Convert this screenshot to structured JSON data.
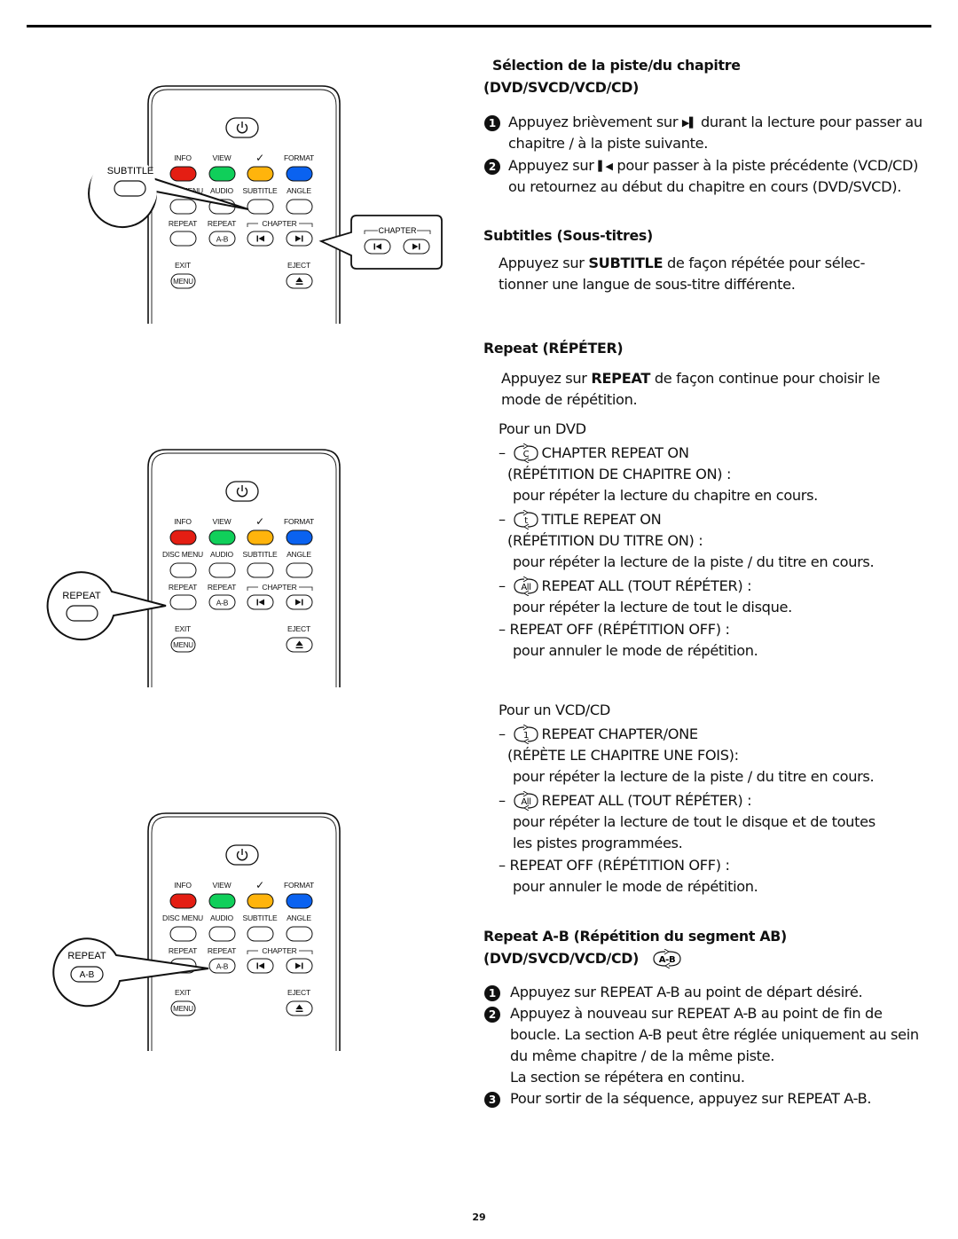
{
  "page_number": "29",
  "colors": {
    "info": "#e41e13",
    "view": "#10cf5a",
    "check": "#ffb40c",
    "format": "#0a62f0"
  },
  "remote": {
    "row1": [
      "INFO",
      "VIEW",
      "✓",
      "FORMAT"
    ],
    "row2": [
      "DISC MENU",
      "AUDIO",
      "SUBTITLE",
      "ANGLE"
    ],
    "row3": [
      "REPEAT",
      "REPEAT",
      "CHAPTER"
    ],
    "ab_label": "A-B",
    "exit_label": "EXIT",
    "menu_label": "MENU",
    "eject_label": "EJECT",
    "prev_icon": "skip-previous-icon",
    "next_icon": "skip-next-icon",
    "power_icon": "power-icon",
    "eject_icon": "eject-icon"
  },
  "callouts": {
    "subtitle": "SUBTITLE",
    "chapter": "CHAPTER",
    "repeat": "REPEAT",
    "repeat_ab": {
      "label": "REPEAT",
      "button": "A-B"
    }
  },
  "sections": {
    "chapter_select": {
      "title_line1": "Sélection de la piste/du chapitre",
      "title_line2": "(DVD/SVCD/VCD/CD)",
      "steps": [
        {
          "n": "1",
          "pre": "Appuyez brièvement sur ",
          "icon": "skip-next-icon",
          "post": " durant la lecture pour passer au",
          "line2": "chapitre / à la piste suivante."
        },
        {
          "n": "2",
          "pre": "Appuyez sur ",
          "icon": "skip-previous-icon",
          "post": " pour passer à la piste précédente (VCD/CD)",
          "line2": "ou retournez au début du chapitre en cours (DVD/SVCD)."
        }
      ]
    },
    "subtitles": {
      "title": "Subtitles (Sous-titres)",
      "pre": "Appuyez sur ",
      "key": "SUBTITLE",
      "post": " de façon répétée pour sélec-",
      "line2": "tionner une langue de sous-titre différente."
    },
    "repeat": {
      "title": "Repeat (RÉPÉTER)",
      "pre": "Appuyez sur ",
      "key": "REPEAT",
      "post": " de façon continue pour choisir le",
      "line2": "mode de répétition.",
      "dvd": {
        "heading": "Pour un DVD",
        "items": [
          {
            "icon_letter": "C",
            "label": "CHAPTER REPEAT ON",
            "label2": "(RÉPÉTITION DE CHAPITRE ON) :",
            "desc": [
              "pour répéter la lecture du chapitre en cours."
            ]
          },
          {
            "icon_letter": "t",
            "label": "TITLE REPEAT ON",
            "label2": "(RÉPÉTITION DU TITRE ON) :",
            "desc": [
              "pour répéter la lecture de la piste / du titre en cours."
            ]
          },
          {
            "icon_letter": "All",
            "label": "REPEAT ALL (TOUT RÉPÉTER) :",
            "desc": [
              "pour répéter la lecture de tout le disque."
            ]
          },
          {
            "label": "– REPEAT OFF (RÉPÉTITION OFF) :",
            "desc": [
              "pour annuler le mode de répétition."
            ]
          }
        ]
      },
      "vcd": {
        "heading": "Pour un VCD/CD",
        "items": [
          {
            "icon_letter": "1",
            "label": "REPEAT CHAPTER/ONE",
            "label2": "(RÉPÈTE LE CHAPITRE UNE FOIS):",
            "desc": [
              "pour répéter la lecture de la piste / du titre en cours."
            ]
          },
          {
            "icon_letter": "All",
            "label": "REPEAT ALL (TOUT RÉPÉTER) :",
            "desc": [
              "pour répéter la lecture de tout le disque et de toutes",
              "les pistes programmées."
            ]
          },
          {
            "label": "– REPEAT OFF (RÉPÉTITION OFF) :",
            "desc": [
              "pour annuler le mode de répétition."
            ]
          }
        ]
      }
    },
    "repeat_ab": {
      "title_line1": "Repeat A-B (Répétition du segment AB)",
      "title_line2": "(DVD/SVCD/VCD/CD)",
      "icon_letter": "A-B",
      "steps": [
        {
          "n": "1",
          "lines": [
            "Appuyez sur REPEAT A-B au point de départ désiré."
          ]
        },
        {
          "n": "2",
          "lines": [
            "Appuyez à nouveau sur REPEAT A-B au point de fin de",
            "boucle. La section A-B peut être réglée uniquement au sein",
            "du même chapitre / de la même piste.",
            "La section se répétera en continu."
          ]
        },
        {
          "n": "3",
          "lines": [
            "Pour sortir de la séquence, appuyez sur REPEAT A-B."
          ]
        }
      ]
    }
  }
}
